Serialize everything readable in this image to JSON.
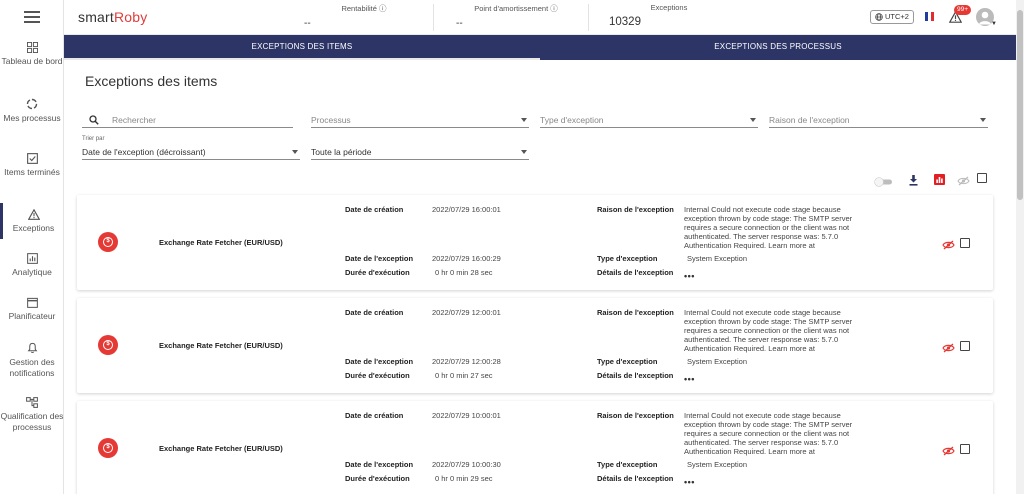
{
  "app": {
    "logo_prefix": "smart",
    "logo_suffix": "Roby"
  },
  "sidebar": {
    "items": [
      {
        "label": "Tableau de bord",
        "icon": "dashboard-icon"
      },
      {
        "label": "Mes processus",
        "icon": "processes-icon"
      },
      {
        "label": "Items terminés",
        "icon": "checkbox-icon"
      },
      {
        "label": "Exceptions",
        "icon": "warning-icon",
        "active": true
      },
      {
        "label": "Analytique",
        "icon": "analytics-icon"
      },
      {
        "label": "Planificateur",
        "icon": "calendar-icon"
      },
      {
        "label": "Gestion des notifications",
        "icon": "bell-icon"
      },
      {
        "label": "Qualification des processus",
        "icon": "flow-icon"
      }
    ]
  },
  "header": {
    "stats": [
      {
        "label": "Rentabilité",
        "value": "--"
      },
      {
        "label": "Point d'amortissement",
        "value": "--"
      },
      {
        "label": "Exceptions",
        "value": "10329"
      }
    ],
    "timezone": "UTC+2",
    "notifications_badge": "99+"
  },
  "tabs": [
    {
      "label": "EXCEPTIONS DES ITEMS",
      "active": true
    },
    {
      "label": "EXCEPTIONS DES PROCESSUS",
      "active": false
    }
  ],
  "page": {
    "title": "Exceptions des items",
    "filters": {
      "search_placeholder": "Rechercher",
      "process_placeholder": "Processus",
      "type_placeholder": "Type d'exception",
      "reason_placeholder": "Raison de l'exception",
      "sort_label": "Trier par",
      "sort_value": "Date de l'exception (décroissant)",
      "period_value": "Toute la période"
    }
  },
  "labels": {
    "created": "Date de création",
    "exception_date": "Date de l'exception",
    "duration": "Durée d'exécution",
    "reason": "Raison de l'exception",
    "type": "Type d'exception",
    "details": "Détails de l'exception",
    "more": "•••"
  },
  "exceptions": [
    {
      "process": "Exchange Rate Fetcher (EUR/USD)",
      "created": "2022/07/29 16:00:01",
      "exception_date": "2022/07/29 16:00:29",
      "duration": "0 hr 0 min 28 sec",
      "reason": "Internal Could not execute code stage because exception thrown by code stage: The SMTP server requires a secure connection or the client was not authenticated. The server response was: 5.7.0 Authentication Required. Learn more at",
      "type": "System Exception"
    },
    {
      "process": "Exchange Rate Fetcher (EUR/USD)",
      "created": "2022/07/29 12:00:01",
      "exception_date": "2022/07/29 12:00:28",
      "duration": "0 hr 0 min 27 sec",
      "reason": "Internal Could not execute code stage because exception thrown by code stage: The SMTP server requires a secure connection or the client was not authenticated. The server response was: 5.7.0 Authentication Required. Learn more at",
      "type": "System Exception"
    },
    {
      "process": "Exchange Rate Fetcher (EUR/USD)",
      "created": "2022/07/29 10:00:01",
      "exception_date": "2022/07/29 10:00:30",
      "duration": "0 hr 0 min 29 sec",
      "reason": "Internal Could not execute code stage because exception thrown by code stage: The SMTP server requires a secure connection or the client was not authenticated. The server response was: 5.7.0 Authentication Required. Learn more at",
      "type": "System Exception"
    }
  ],
  "colors": {
    "primary": "#2d3566",
    "danger": "#e53935",
    "export_red": "#e31f26"
  }
}
